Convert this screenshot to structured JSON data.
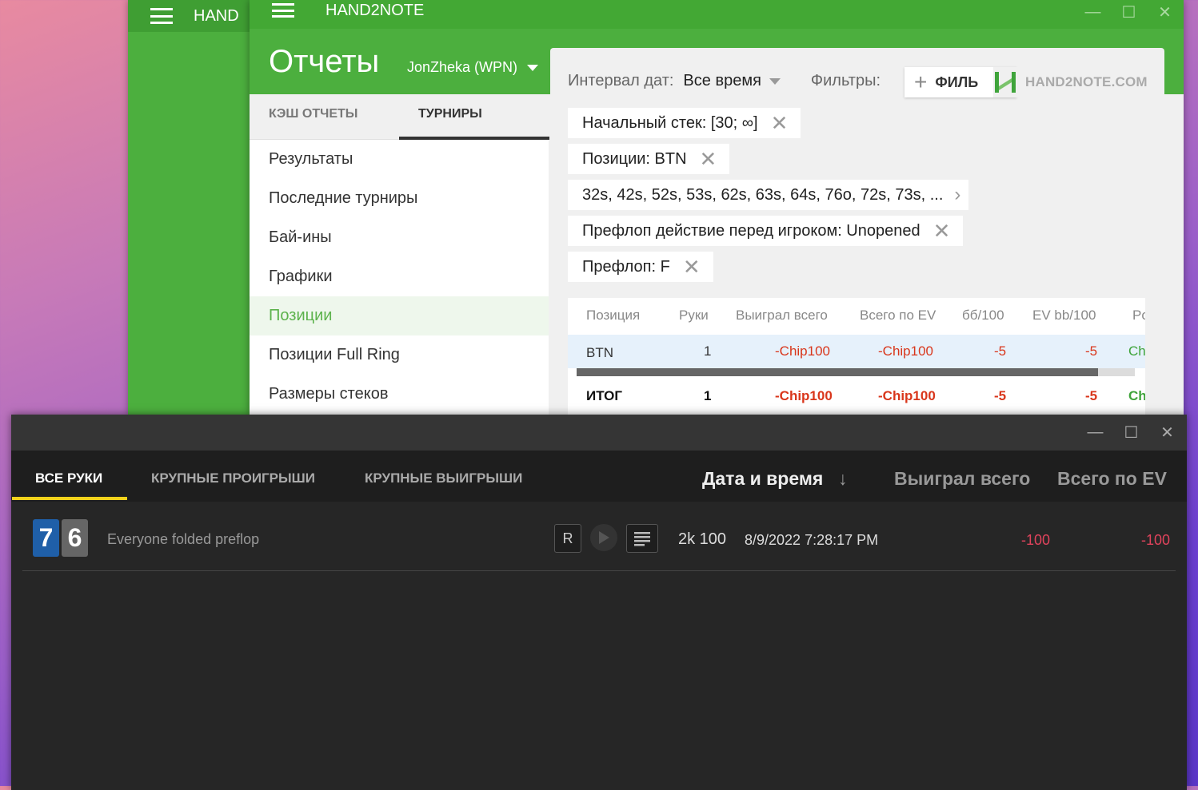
{
  "back_window": {
    "title": "HAND"
  },
  "app": {
    "title": "HAND2NOTE",
    "reports_title": "Отчеты",
    "user": "JonZheka (WPN)",
    "tabs": [
      "КЭШ ОТЧЕТЫ",
      "ТУРНИРЫ"
    ],
    "nav_items": [
      "Результаты",
      "Последние турниры",
      "Бай-ины",
      "Графики",
      "Позиции",
      "Позиции Full Ring",
      "Размеры стеков"
    ],
    "active_nav": "Позиции",
    "date_interval_label": "Интервал дат:",
    "date_interval_value": "Все время",
    "filters_label": "Фильтры:",
    "add_filter_label": "ФИЛЬ",
    "logo_text": "HAND2NOTE.COM",
    "chips": [
      "Начальный стек: [30; ∞]",
      "Позиции: BTN",
      "32s, 42s, 52s, 53s, 62s, 63s, 64s, 76o, 72s, 73s, ...",
      "Префлоп действие перед игроком: Unopened",
      "Префлоп: F"
    ],
    "table": {
      "headers": [
        "Позиция",
        "Руки",
        "Выиграл всего",
        "Всего по EV",
        "бб/100",
        "EV bb/100",
        "Po"
      ],
      "row": [
        "BTN",
        "1",
        "-Chip100",
        "-Chip100",
        "-5",
        "-5",
        "Ch"
      ],
      "total": [
        "ИТОГ",
        "1",
        "-Chip100",
        "-Chip100",
        "-5",
        "-5",
        "Ch"
      ]
    }
  },
  "hands_window": {
    "tabs": [
      "ВСЕ РУКИ",
      "КРУПНЫЕ ПРОИГРЫШИ",
      "КРУПНЫЕ ВЫИГРЫШИ"
    ],
    "sort_headers": [
      "Дата и время",
      "↓",
      "Выиграл всего",
      "Всего по EV"
    ],
    "hand": {
      "cards": [
        "7",
        "6"
      ],
      "description": "Everyone folded preflop",
      "r_label": "R",
      "stakes": "2k 100",
      "datetime": "8/9/2022 7:28:17 PM",
      "won": "-100",
      "ev": "-100"
    }
  },
  "colors": {
    "green": "#4caf3e",
    "loss": "#d9361b",
    "dark_loss": "#e0435c",
    "accent_yellow": "#f2d21b"
  }
}
